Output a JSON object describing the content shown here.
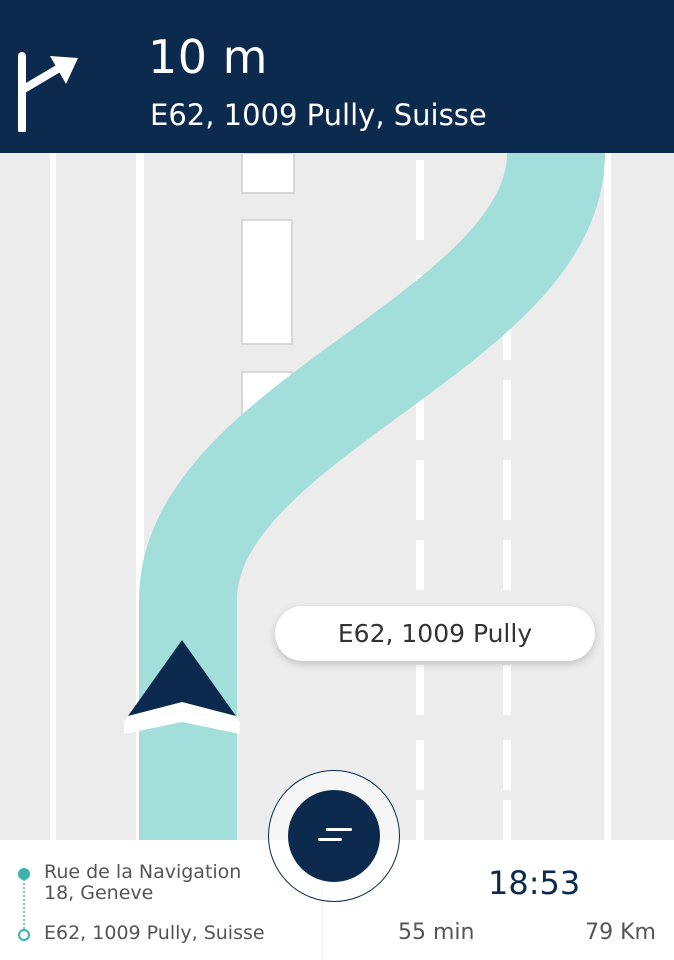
{
  "instruction": {
    "distance": "10 m",
    "street": "E62, 1009 Pully, Suisse",
    "icon": "turn-right-arrow-icon"
  },
  "map": {
    "road_label": "E62, 1009 Pully",
    "colors": {
      "background": "#ececec",
      "route": "#a3dfda",
      "lane_marking": "#ffffff",
      "marker": "#0b2a4d"
    }
  },
  "trip": {
    "origin": "Rue de la Navigation 18, Geneve",
    "destination": "E62, 1009 Pully, Suisse",
    "arrival_time": "18:53",
    "duration": "55 min",
    "distance": "79 Km"
  },
  "menu_button": {
    "icon": "menu-icon"
  },
  "theme": {
    "header_bg": "#0b2a4d",
    "accent": "#3bb3ac"
  }
}
